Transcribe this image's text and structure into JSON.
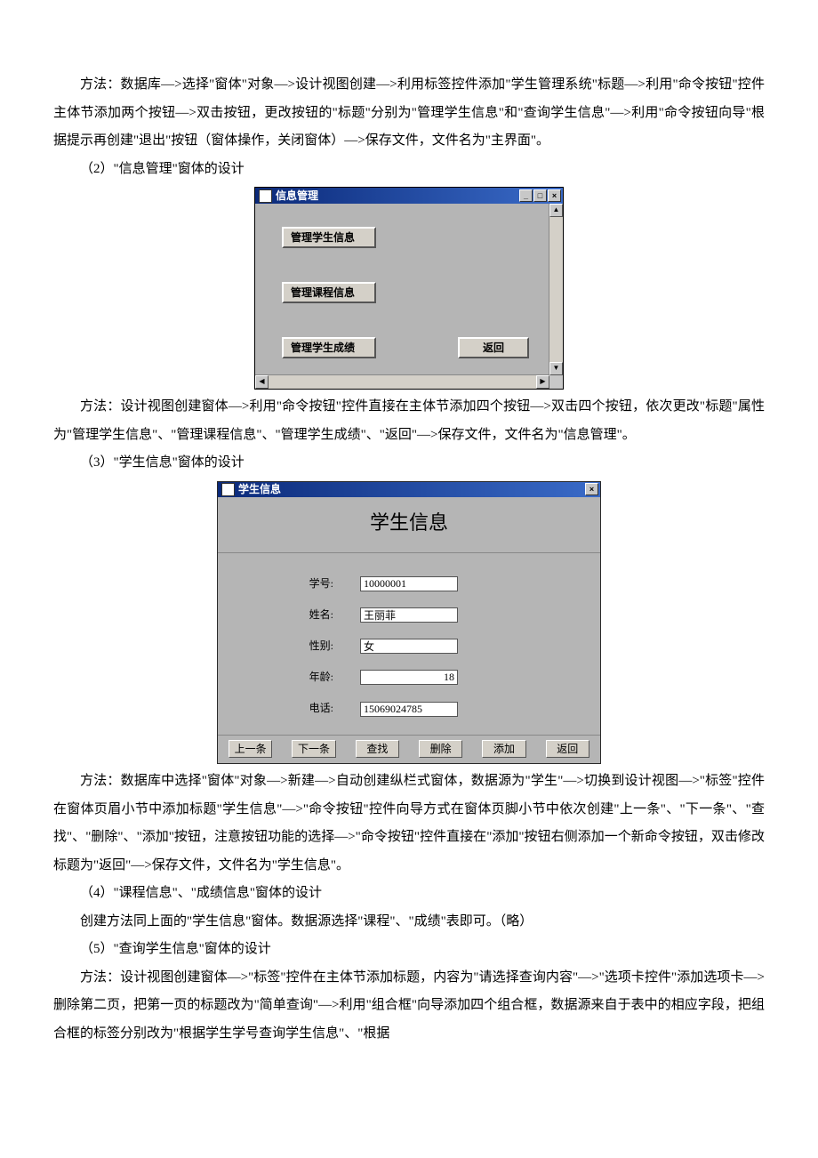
{
  "p1": "方法：数据库—>选择\"窗体\"对象—>设计视图创建—>利用标签控件添加\"学生管理系统\"标题—>利用\"命令按钮\"控件主体节添加两个按钮—>双击按钮，更改按钮的\"标题\"分别为\"管理学生信息\"和\"查询学生信息\"—>利用\"命令按钮向导\"根据提示再创建\"退出\"按钮（窗体操作，关闭窗体）—>保存文件，文件名为\"主界面\"。",
  "h2": "（2）\"信息管理\"窗体的设计",
  "window1": {
    "title": "信息管理",
    "btn1": "管理学生信息",
    "btn2": "管理课程信息",
    "btn3": "管理学生成绩",
    "btn4": "返回"
  },
  "p2": "方法：设计视图创建窗体—>利用\"命令按钮\"控件直接在主体节添加四个按钮—>双击四个按钮，依次更改\"标题\"属性为\"管理学生信息\"、\"管理课程信息\"、\"管理学生成绩\"、\"返回\"—>保存文件，文件名为\"信息管理\"。",
  "h3": "（3）\"学生信息\"窗体的设计",
  "window2": {
    "title": "学生信息",
    "heading": "学生信息",
    "labels": {
      "id": "学号:",
      "name": "姓名:",
      "sex": "性别:",
      "age": "年龄:",
      "phone": "电话:"
    },
    "values": {
      "id": "10000001",
      "name": "王丽菲",
      "sex": "女",
      "age": "18",
      "phone": "15069024785"
    },
    "buttons": [
      "上一条",
      "下一条",
      "查找",
      "删除",
      "添加",
      "返回"
    ]
  },
  "p3": "方法：数据库中选择\"窗体\"对象—>新建—>自动创建纵栏式窗体，数据源为\"学生\"—>切换到设计视图—>\"标签\"控件在窗体页眉小节中添加标题\"学生信息\"—>\"命令按钮\"控件向导方式在窗体页脚小节中依次创建\"上一条\"、\"下一条\"、\"查找\"、\"删除\"、\"添加\"按钮，注意按钮功能的选择—>\"命令按钮\"控件直接在\"添加\"按钮右侧添加一个新命令按钮，双击修改标题为\"返回\"—>保存文件，文件名为\"学生信息\"。",
  "h4": "（4）\"课程信息\"、\"成绩信息\"窗体的设计",
  "p4": "创建方法同上面的\"学生信息\"窗体。数据源选择\"课程\"、\"成绩\"表即可。（略）",
  "h5": "（5）\"查询学生信息\"窗体的设计",
  "p5": "方法：设计视图创建窗体—>\"标签\"控件在主体节添加标题，内容为\"请选择查询内容\"—>\"选项卡控件\"添加选项卡—>删除第二页，把第一页的标题改为\"简单查询\"—>利用\"组合框\"向导添加四个组合框，数据源来自于表中的相应字段，把组合框的标签分别改为\"根据学生学号查询学生信息\"、\"根据"
}
